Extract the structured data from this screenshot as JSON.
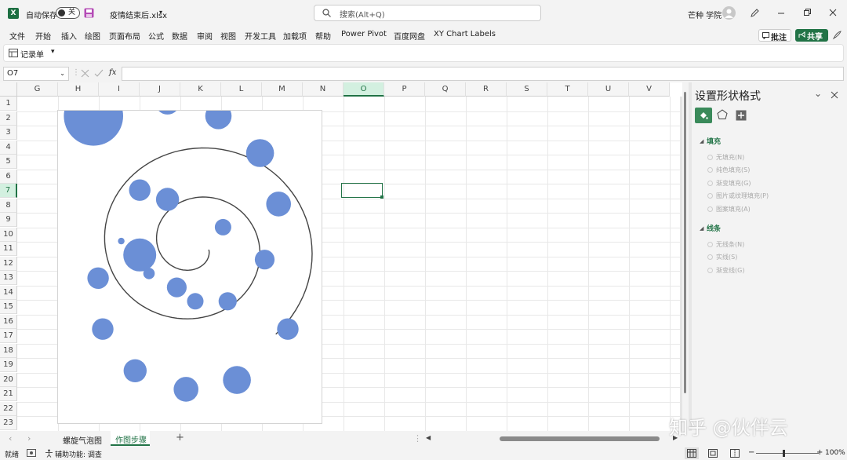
{
  "titlebar": {
    "autosave_label": "自动保存",
    "autosave_state": "关",
    "filename": "疫情结束后.xlsx",
    "search_placeholder": "搜索(Alt+Q)",
    "user_name": "芒种 学院"
  },
  "menu": [
    "文件",
    "开始",
    "插入",
    "绘图",
    "页面布局",
    "公式",
    "数据",
    "审阅",
    "视图",
    "开发工具",
    "加载项",
    "帮助",
    "Power Pivot",
    "百度网盘",
    "XY Chart Labels"
  ],
  "actions": {
    "comment_label": "批注",
    "share_label": "共享"
  },
  "ribbon": {
    "record_label": "记录单",
    "dropdown_glyph": "▾"
  },
  "formula_bar": {
    "cell_ref": "O7",
    "fx": "fx",
    "value": ""
  },
  "columns": [
    "G",
    "H",
    "I",
    "J",
    "K",
    "L",
    "M",
    "N",
    "O",
    "P",
    "Q",
    "R",
    "S",
    "T",
    "U",
    "V"
  ],
  "rows": [
    "1",
    "2",
    "3",
    "4",
    "5",
    "6",
    "7",
    "8",
    "9",
    "10",
    "11",
    "12",
    "13",
    "14",
    "15",
    "16",
    "17",
    "18",
    "19",
    "20",
    "21",
    "22",
    "23"
  ],
  "active_cell": "O7",
  "chart_data": {
    "type": "bubble",
    "series": [
      {
        "values": [
          {
            "x": -0.6,
            "y": -0.1,
            "size": 1.0
          },
          {
            "x": -0.3,
            "y": 0.5,
            "size": 0.7
          },
          {
            "x": -0.6,
            "y": 0.6,
            "size": 0.65
          },
          {
            "x": -0.2,
            "y": -0.45,
            "size": 0.6
          },
          {
            "x": 0.35,
            "y": -0.6,
            "size": 0.55
          },
          {
            "x": 0.75,
            "y": -0.15,
            "size": 0.6
          },
          {
            "x": 0.9,
            "y": 0.45,
            "size": 0.75
          },
          {
            "x": 0.7,
            "y": 1.0,
            "size": 0.85
          },
          {
            "x": 0.25,
            "y": 1.4,
            "size": 0.8
          },
          {
            "x": -0.3,
            "y": 1.55,
            "size": 0.75
          },
          {
            "x": -1.1,
            "y": 1.4,
            "size": 1.8
          },
          {
            "x": 1.0,
            "y": -0.9,
            "size": 0.65
          },
          {
            "x": 0.0,
            "y": -0.6,
            "size": 0.5
          },
          {
            "x": -0.5,
            "y": -0.3,
            "size": 0.35
          },
          {
            "x": -0.8,
            "y": 0.05,
            "size": 0.2
          },
          {
            "x": -1.05,
            "y": -0.35,
            "size": 0.65
          },
          {
            "x": -1.0,
            "y": -0.9,
            "size": 0.65
          },
          {
            "x": -0.65,
            "y": -1.35,
            "size": 0.7
          },
          {
            "x": -0.1,
            "y": -1.55,
            "size": 0.75
          },
          {
            "x": 0.45,
            "y": -1.45,
            "size": 0.85
          },
          {
            "x": 0.3,
            "y": 0.2,
            "size": 0.5
          }
        ]
      }
    ],
    "spiral_line": true,
    "bubble_color": "#6b8fd6",
    "line_color": "#444444"
  },
  "panel": {
    "title": "设置形状格式",
    "fill_section": "填充",
    "fill_options": [
      "无填充(N)",
      "纯色填充(S)",
      "渐变填充(G)",
      "图片或纹理填充(P)",
      "图案填充(A)"
    ],
    "line_section": "线条",
    "line_options": [
      "无线条(N)",
      "实线(S)",
      "渐变线(G)"
    ]
  },
  "sheet_tabs": [
    "螺旋气泡图",
    "作图步骤"
  ],
  "active_sheet": "作图步骤",
  "add_sheet_glyph": "+",
  "statusbar": {
    "ready": "就绪",
    "accessibility": "辅助功能: 调查",
    "zoom": "100%"
  },
  "watermark": "知乎 @伙伴云",
  "colors": {
    "excel_green": "#1d6f42",
    "bubble": "#6b8fd6",
    "accent": "#217346"
  }
}
